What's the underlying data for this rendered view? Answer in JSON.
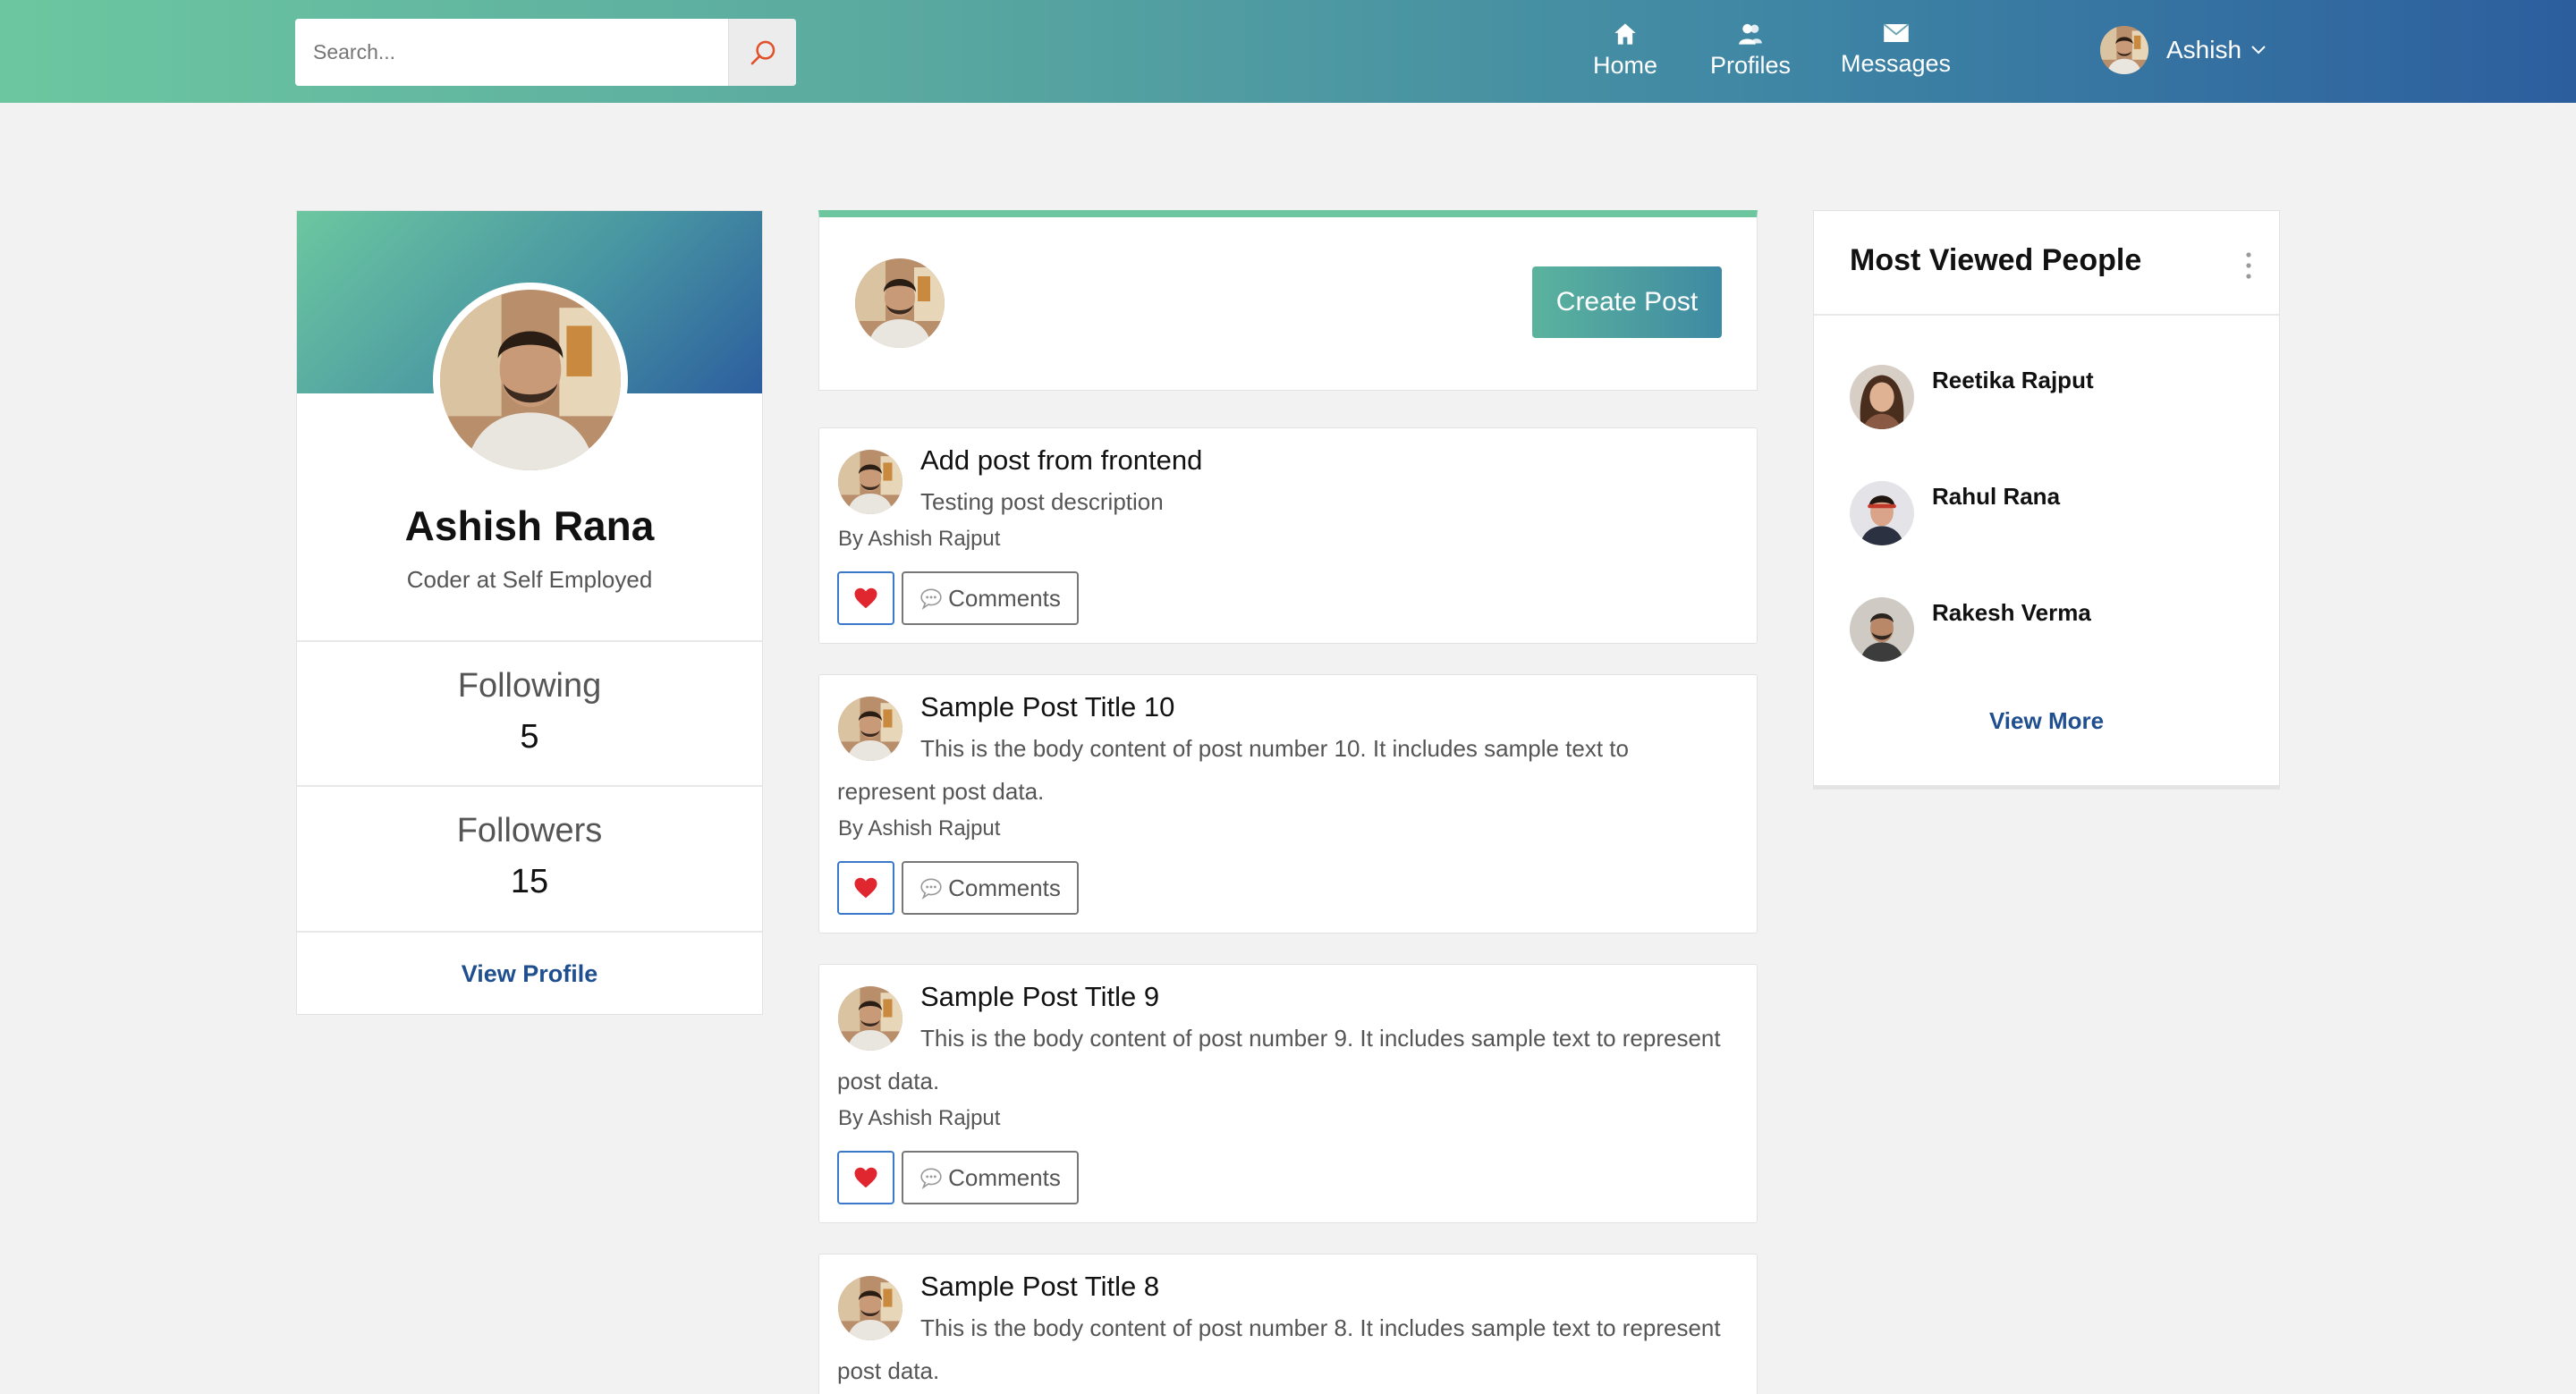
{
  "colors": {
    "brand_gradient_start": "#6cc7a0",
    "brand_gradient_end": "#2c5e9e",
    "link": "#1f4f8f",
    "like_border": "#3a78c9",
    "heart": "#e0262f"
  },
  "navbar": {
    "search_placeholder": "Search...",
    "search_icon": "magnifier-icon",
    "items": [
      {
        "label": "Home",
        "icon": "home-icon"
      },
      {
        "label": "Profiles",
        "icon": "users-icon"
      },
      {
        "label": "Messages",
        "icon": "envelope-icon"
      }
    ],
    "user_name": "Ashish"
  },
  "profile": {
    "name": "Ashish Rana",
    "headline": "Coder at Self Employed",
    "following_label": "Following",
    "following_count": "5",
    "followers_label": "Followers",
    "followers_count": "15",
    "view_profile": "View Profile"
  },
  "create_post": {
    "button_label": "Create Post"
  },
  "posts": [
    {
      "title": "Add post from frontend",
      "body": "Testing post description",
      "author": "By Ashish Rajput",
      "comments_label": "Comments"
    },
    {
      "title": "Sample Post Title 10",
      "body": "This is the body content of post number 10. It includes sample text to represent post data.",
      "author": "By Ashish Rajput",
      "comments_label": "Comments"
    },
    {
      "title": "Sample Post Title 9",
      "body": "This is the body content of post number 9. It includes sample text to represent post data.",
      "author": "By Ashish Rajput",
      "comments_label": "Comments"
    },
    {
      "title": "Sample Post Title 8",
      "body": "This is the body content of post number 8. It includes sample text to represent post data.",
      "author": "",
      "comments_label": ""
    }
  ],
  "most_viewed": {
    "title": "Most Viewed People",
    "people": [
      {
        "name": "Reetika Rajput"
      },
      {
        "name": "Rahul Rana"
      },
      {
        "name": "Rakesh Verma"
      }
    ],
    "view_more": "View More"
  }
}
